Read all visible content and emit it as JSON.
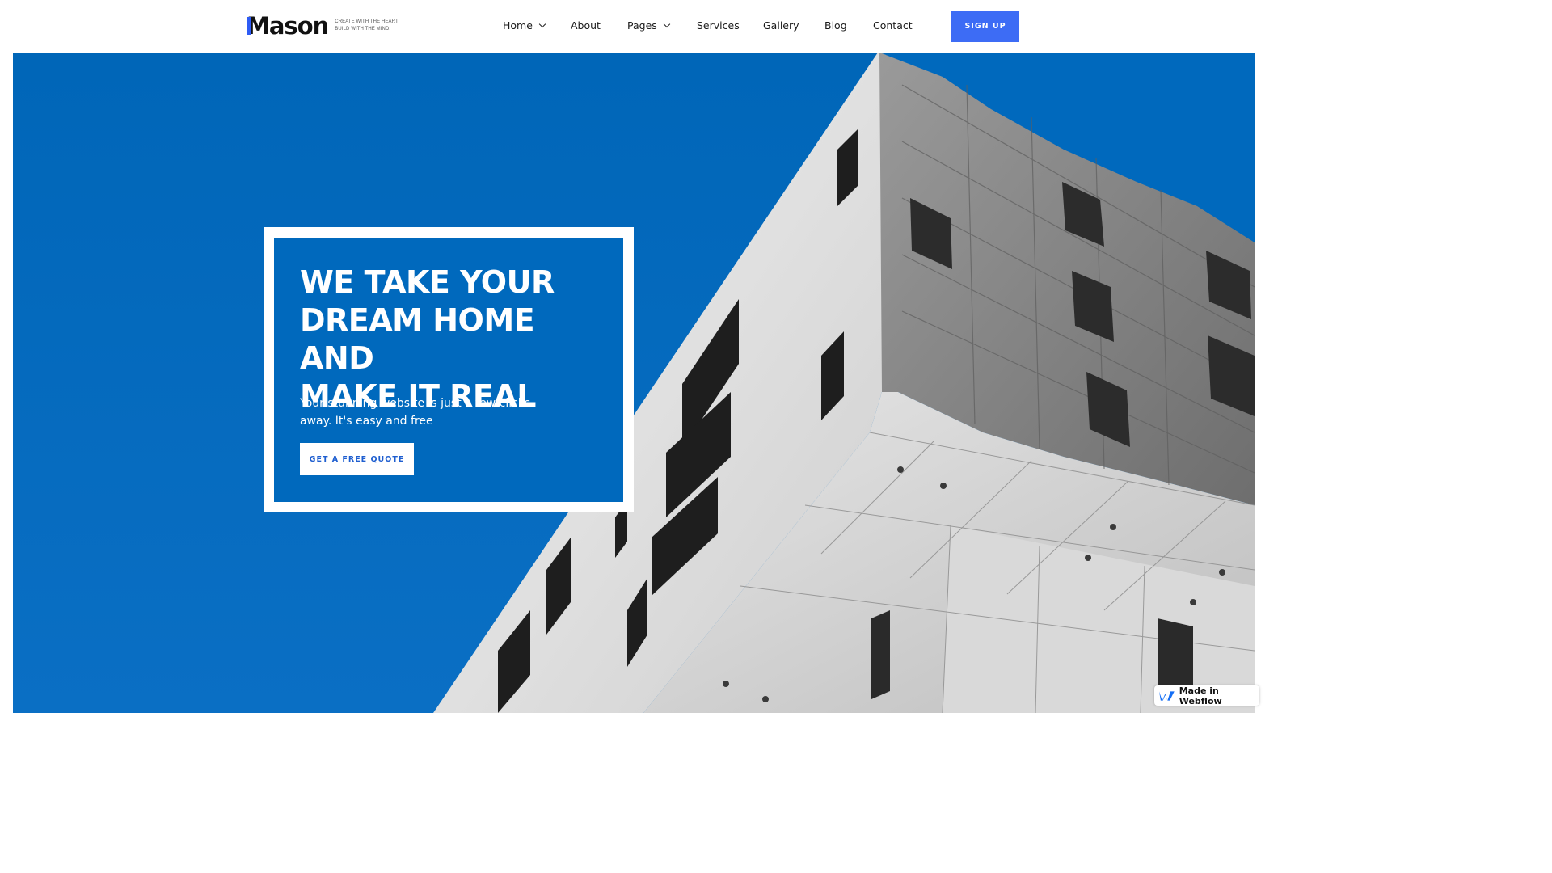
{
  "brand": {
    "name": "Mason",
    "tagline_line1": "CREATE WITH THE HEART",
    "tagline_line2": "BUILD WITH THE MIND.",
    "accent_color": "#2f5cf5"
  },
  "nav": {
    "items": [
      {
        "label": "Home",
        "has_dropdown": true
      },
      {
        "label": "About",
        "has_dropdown": false
      },
      {
        "label": "Pages",
        "has_dropdown": true
      },
      {
        "label": "Services",
        "has_dropdown": false
      },
      {
        "label": "Gallery",
        "has_dropdown": false
      },
      {
        "label": "Blog",
        "has_dropdown": false
      },
      {
        "label": "Contact",
        "has_dropdown": false
      }
    ],
    "signup_label": "SIGN UP"
  },
  "hero": {
    "title_line1": "WE TAKE YOUR",
    "title_line2": "DREAM HOME AND",
    "title_line3": "MAKE IT REAL",
    "subtitle_line1": "Your stunning website is just a few clicks",
    "subtitle_line2": "away. It's easy and free",
    "cta_label": "GET A FREE QUOTE",
    "background_color": "#0069bd"
  },
  "badge": {
    "label": "Made in Webflow",
    "icon": "webflow-logo-icon"
  }
}
